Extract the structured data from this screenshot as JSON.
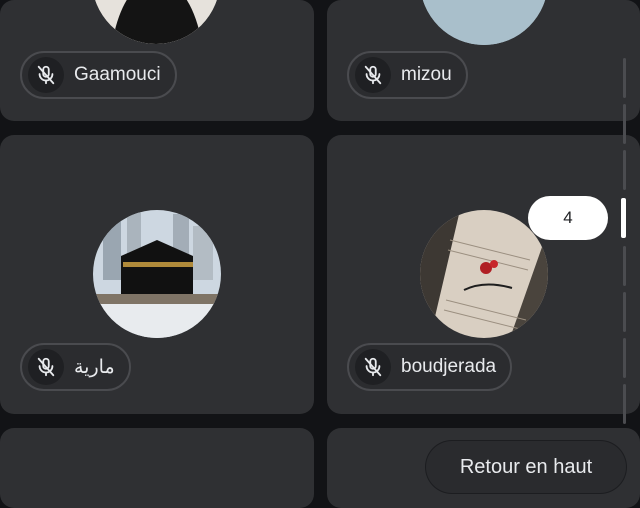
{
  "participants": [
    {
      "name": "Gaamouci",
      "mic": "mic-off-icon"
    },
    {
      "name": "mizou",
      "mic": "mic-off-icon"
    },
    {
      "name": "مارية",
      "mic": "mic-off-icon"
    },
    {
      "name": "boudjerada",
      "mic": "mic-off-icon"
    }
  ],
  "page_indicator": "4",
  "back_to_top_label": "Retour en haut",
  "colors": {
    "background": "#121316",
    "tile": "#2f3033",
    "pill_border": "#4a4b4f",
    "badge": "#ffffff"
  }
}
